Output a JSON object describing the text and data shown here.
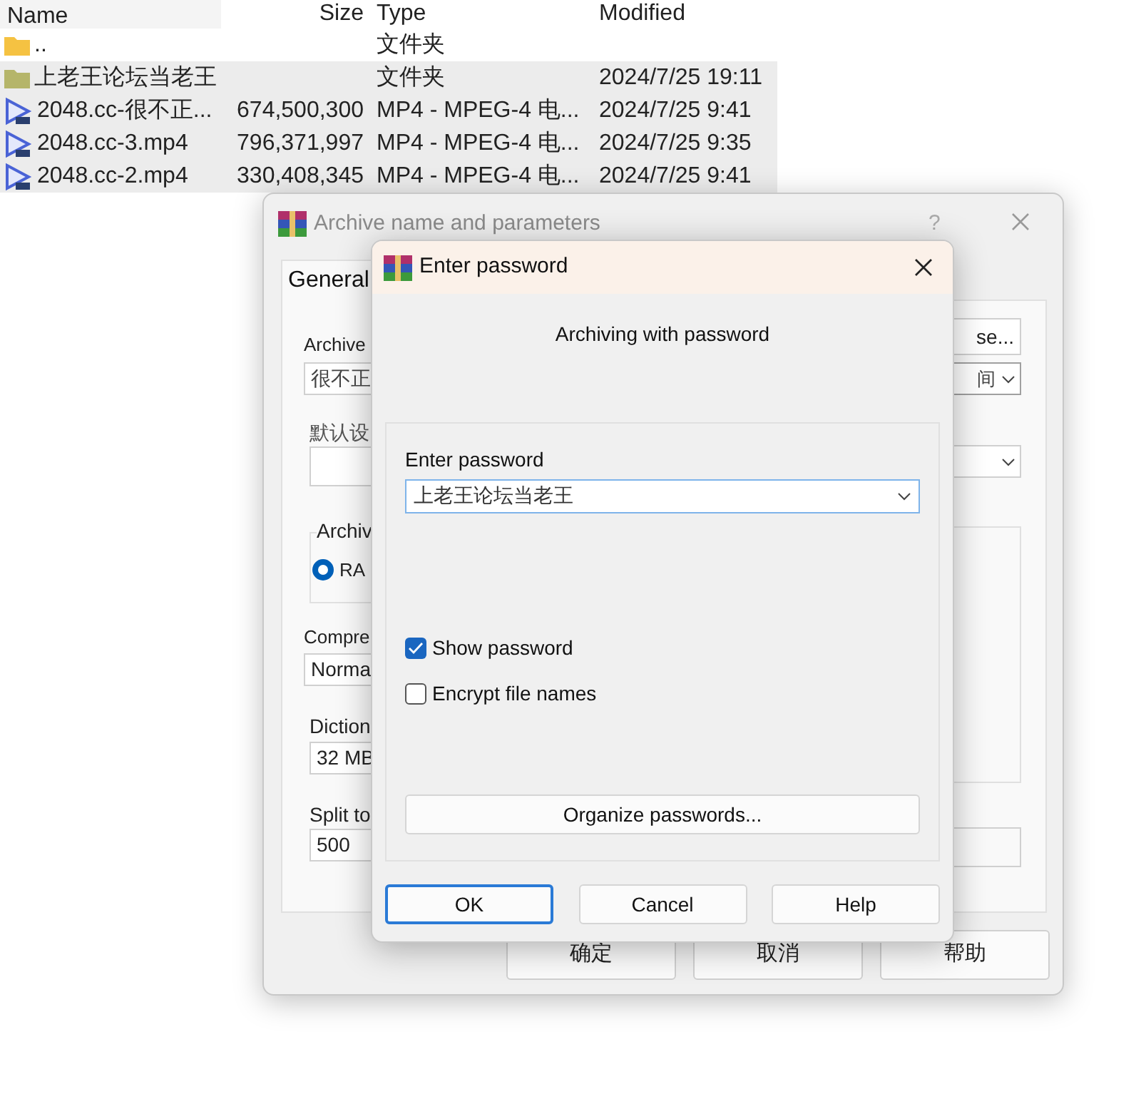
{
  "file_list": {
    "columns": [
      "Name",
      "Size",
      "Type",
      "Modified"
    ],
    "rows": [
      {
        "kind": "parent",
        "selected": false,
        "name": "..",
        "size": "",
        "type": "文件夹",
        "modified": ""
      },
      {
        "kind": "folder",
        "selected": true,
        "name": "上老王论坛当老王",
        "size": "",
        "type": "文件夹",
        "modified": "2024/7/25 19:11"
      },
      {
        "kind": "video",
        "selected": true,
        "name": "2048.cc-很不正...",
        "size": "674,500,300",
        "type": "MP4 - MPEG-4 电...",
        "modified": "2024/7/25 9:41"
      },
      {
        "kind": "video",
        "selected": true,
        "name": "2048.cc-3.mp4",
        "size": "796,371,997",
        "type": "MP4 - MPEG-4 电...",
        "modified": "2024/7/25 9:35"
      },
      {
        "kind": "video",
        "selected": true,
        "name": "2048.cc-2.mp4",
        "size": "330,408,345",
        "type": "MP4 - MPEG-4 电...",
        "modified": "2024/7/25 9:41"
      }
    ]
  },
  "archive_dialog": {
    "title": "Archive name and parameters",
    "help": "?",
    "tab": "General",
    "archive_label": "Archive",
    "archive_value": "很不正",
    "browse": "se...",
    "update_mode": "间",
    "profile_label": "默认设",
    "format_label": "Archiv",
    "format_option": {
      "label": "RA",
      "selected": true
    },
    "compression_label": "Compre",
    "compression_value": "Norma",
    "dictionary_label": "Diction",
    "dictionary_value": "32 MB",
    "split_label": "Split to",
    "split_value": "500",
    "buttons": [
      "确定",
      "取消",
      "帮助"
    ]
  },
  "password_dialog": {
    "title": "Enter password",
    "heading": "Archiving with password",
    "password_label": "Enter password",
    "password_value": "上老王论坛当老王",
    "options": [
      {
        "label": "Show password",
        "checked": true
      },
      {
        "label": "Encrypt file names",
        "checked": false
      }
    ],
    "organize": "Organize passwords...",
    "buttons": [
      {
        "label": "OK",
        "default": true
      },
      {
        "label": "Cancel",
        "default": false
      },
      {
        "label": "Help",
        "default": false
      }
    ]
  }
}
